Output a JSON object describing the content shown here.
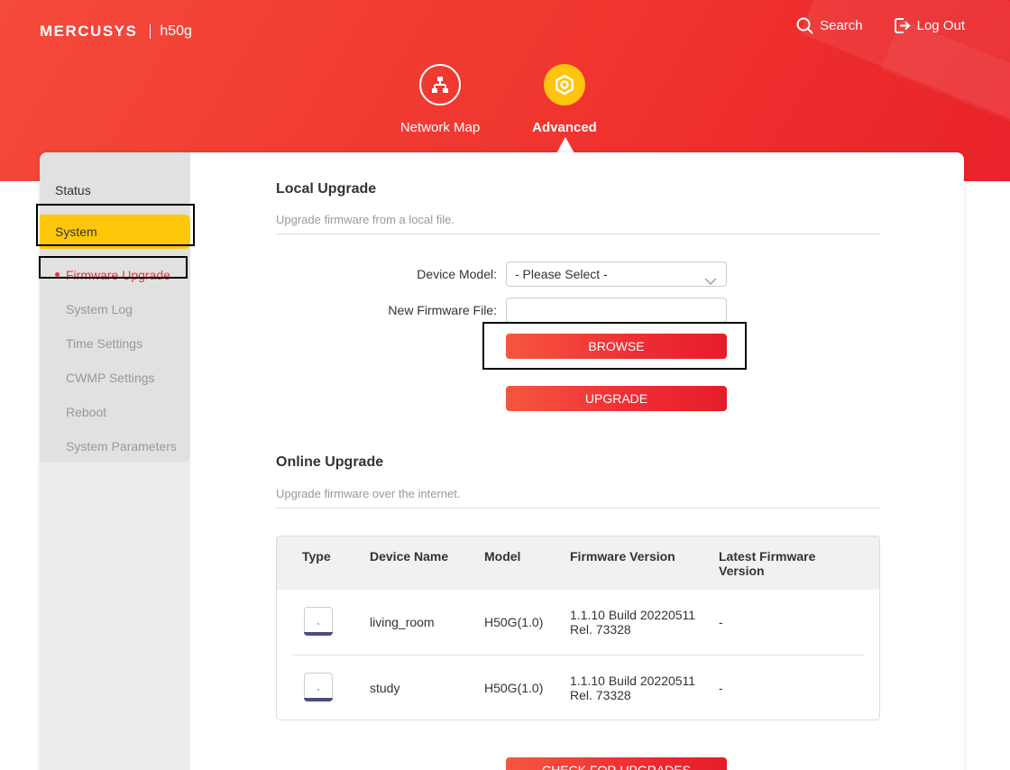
{
  "header": {
    "brand": "MERCUSYS",
    "model": "h50g",
    "search_label": "Search",
    "logout_label": "Log Out"
  },
  "nav": {
    "items": [
      {
        "label": "Network Map",
        "icon": "network-map-icon"
      },
      {
        "label": "Advanced",
        "icon": "gear-icon",
        "active": true
      }
    ]
  },
  "sidebar": {
    "status_label": "Status",
    "system_label": "System",
    "sub_items": [
      {
        "label": "Firmware Upgrade",
        "active": true
      },
      {
        "label": "System Log"
      },
      {
        "label": "Time Settings"
      },
      {
        "label": "CWMP Settings"
      },
      {
        "label": "Reboot"
      },
      {
        "label": "System Parameters"
      }
    ]
  },
  "local_upgrade": {
    "title": "Local Upgrade",
    "description": "Upgrade firmware from a local file.",
    "device_model_label": "Device Model:",
    "device_model_value": "- Please Select -",
    "firmware_file_label": "New Firmware File:",
    "firmware_file_value": "",
    "browse_label": "BROWSE",
    "upgrade_label": "UPGRADE"
  },
  "online_upgrade": {
    "title": "Online Upgrade",
    "description": "Upgrade firmware over the internet.",
    "columns": [
      "Type",
      "Device Name",
      "Model",
      "Firmware Version",
      "Latest Firmware Version"
    ],
    "rows": [
      {
        "type_icon": "mesh-unit-icon",
        "device_name": "living_room",
        "model": "H50G(1.0)",
        "firmware_line1": "1.1.10 Build 20220511",
        "firmware_line2": "Rel. 73328",
        "latest": "-"
      },
      {
        "type_icon": "mesh-unit-icon",
        "device_name": "study",
        "model": "H50G(1.0)",
        "firmware_line1": "1.1.10 Build 20220511",
        "firmware_line2": "Rel. 73328",
        "latest": "-"
      }
    ],
    "check_label": "CHECK FOR UPGRADES"
  },
  "colors": {
    "brand_red": "#f0352f",
    "accent_yellow": "#ffc40d",
    "active_text": "#e8323d"
  }
}
